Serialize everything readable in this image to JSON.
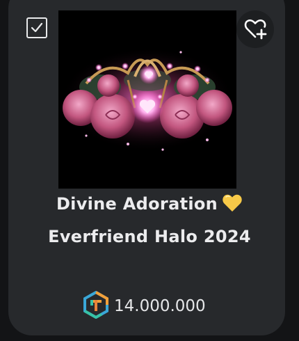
{
  "item": {
    "name_line1": "Divine Adoration",
    "name_line2": "Everfriend Halo 2024",
    "price": "14.000.000",
    "selected": true,
    "name_emoji": "yellow-heart"
  },
  "icons": {
    "checkbox": "check-icon",
    "favorite": "heart-plus-icon",
    "currency": "robux-icon"
  },
  "colors": {
    "card": "#27292c",
    "background": "#131416",
    "text": "#ececee",
    "heart": "#f7c948"
  }
}
